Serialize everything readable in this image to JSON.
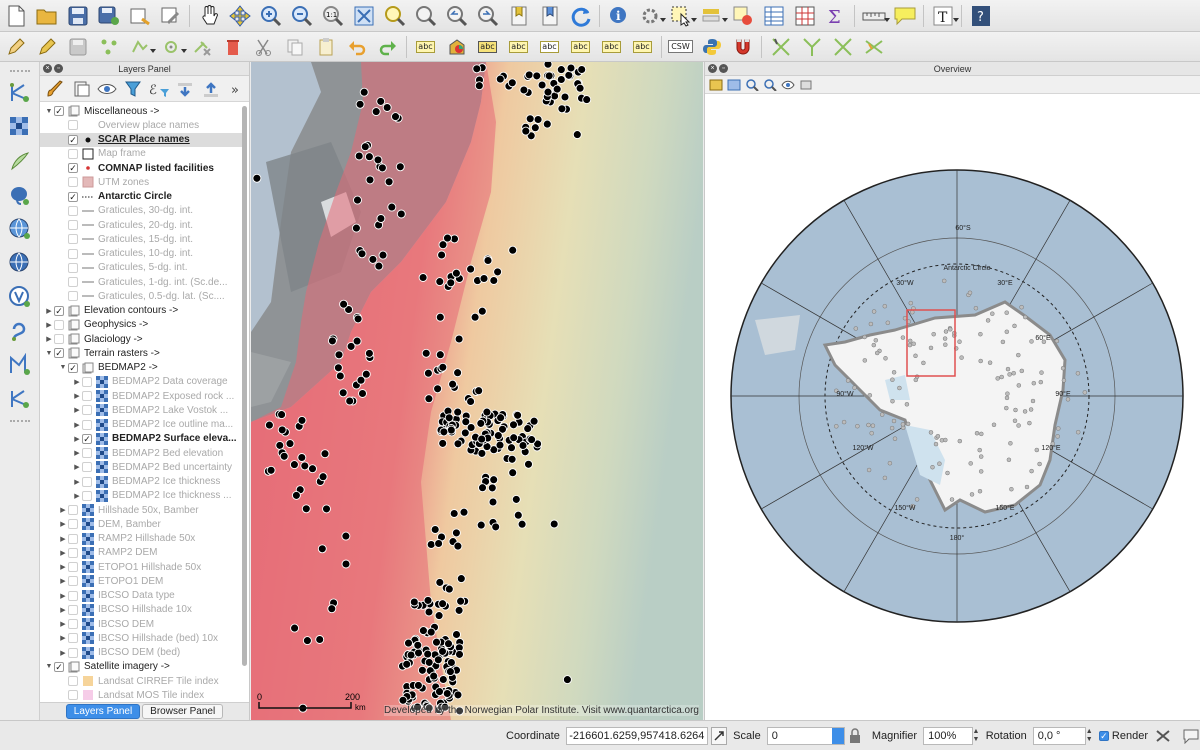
{
  "layers_panel": {
    "title": "Layers Panel",
    "rows": [
      {
        "label": "Miscellaneous ->",
        "kind": "group",
        "expanded": true,
        "checked": true,
        "indent": 0
      },
      {
        "label": "Overview place names",
        "kind": "layer",
        "checked": false,
        "indent": 1,
        "off": true,
        "symbol": "none"
      },
      {
        "label": "SCAR Place names",
        "kind": "layer",
        "checked": true,
        "indent": 1,
        "bold": true,
        "underline": true,
        "selected": true,
        "symbol": "dot"
      },
      {
        "label": "Map frame",
        "kind": "layer",
        "checked": false,
        "indent": 1,
        "off": true,
        "symbol": "square"
      },
      {
        "label": "COMNAP listed facilities",
        "kind": "layer",
        "checked": true,
        "indent": 1,
        "bold": true,
        "symbol": "reddot"
      },
      {
        "label": "UTM zones",
        "kind": "layer",
        "checked": false,
        "indent": 1,
        "off": true,
        "symbol": "pink"
      },
      {
        "label": "Antarctic Circle",
        "kind": "layer",
        "checked": true,
        "indent": 1,
        "bold": true,
        "symbol": "dotline"
      },
      {
        "label": "Graticules, 30-dg. int.",
        "kind": "layer",
        "checked": false,
        "indent": 1,
        "off": true,
        "symbol": "line"
      },
      {
        "label": "Graticules, 20-dg. int.",
        "kind": "layer",
        "checked": false,
        "indent": 1,
        "off": true,
        "symbol": "line"
      },
      {
        "label": "Graticules, 15-dg. int.",
        "kind": "layer",
        "checked": false,
        "indent": 1,
        "off": true,
        "symbol": "line"
      },
      {
        "label": "Graticules, 10-dg. int.",
        "kind": "layer",
        "checked": false,
        "indent": 1,
        "off": true,
        "symbol": "line"
      },
      {
        "label": "Graticules, 5-dg. int.",
        "kind": "layer",
        "checked": false,
        "indent": 1,
        "off": true,
        "symbol": "line"
      },
      {
        "label": "Graticules, 1-dg. int. (Sc.de...",
        "kind": "layer",
        "checked": false,
        "indent": 1,
        "off": true,
        "symbol": "line"
      },
      {
        "label": "Graticules, 0.5-dg. lat. (Sc....",
        "kind": "layer",
        "checked": false,
        "indent": 1,
        "off": true,
        "symbol": "line"
      },
      {
        "label": "Elevation contours ->",
        "kind": "group",
        "expanded": false,
        "checked": true,
        "indent": 0
      },
      {
        "label": "Geophysics ->",
        "kind": "group",
        "expanded": false,
        "checked": false,
        "indent": 0
      },
      {
        "label": "Glaciology ->",
        "kind": "group",
        "expanded": false,
        "checked": false,
        "indent": 0
      },
      {
        "label": "Terrain rasters ->",
        "kind": "group",
        "expanded": true,
        "checked": true,
        "indent": 0
      },
      {
        "label": "BEDMAP2 ->",
        "kind": "group",
        "expanded": true,
        "checked": true,
        "indent": 1
      },
      {
        "label": "BEDMAP2 Data coverage",
        "kind": "raster",
        "checked": false,
        "indent": 2,
        "off": true,
        "expandable": true
      },
      {
        "label": "BEDMAP2 Exposed rock ...",
        "kind": "raster",
        "checked": false,
        "indent": 2,
        "off": true,
        "expandable": true
      },
      {
        "label": "BEDMAP2 Lake Vostok ...",
        "kind": "raster",
        "checked": false,
        "indent": 2,
        "off": true,
        "expandable": true
      },
      {
        "label": "BEDMAP2 Ice outline ma...",
        "kind": "raster",
        "checked": false,
        "indent": 2,
        "off": true,
        "expandable": true
      },
      {
        "label": "BEDMAP2 Surface eleva...",
        "kind": "raster",
        "checked": true,
        "indent": 2,
        "bold": true,
        "expandable": true
      },
      {
        "label": "BEDMAP2 Bed elevation",
        "kind": "raster",
        "checked": false,
        "indent": 2,
        "off": true,
        "expandable": true
      },
      {
        "label": "BEDMAP2 Bed uncertainty",
        "kind": "raster",
        "checked": false,
        "indent": 2,
        "off": true,
        "expandable": true
      },
      {
        "label": "BEDMAP2 Ice thickness",
        "kind": "raster",
        "checked": false,
        "indent": 2,
        "off": true,
        "expandable": true
      },
      {
        "label": "BEDMAP2 Ice thickness ...",
        "kind": "raster",
        "checked": false,
        "indent": 2,
        "off": true,
        "expandable": true
      },
      {
        "label": "Hillshade 50x, Bamber",
        "kind": "raster",
        "checked": false,
        "indent": 1,
        "off": true,
        "expandable": true
      },
      {
        "label": "DEM, Bamber",
        "kind": "raster",
        "checked": false,
        "indent": 1,
        "off": true,
        "expandable": true
      },
      {
        "label": "RAMP2 Hillshade 50x",
        "kind": "raster",
        "checked": false,
        "indent": 1,
        "off": true,
        "expandable": true
      },
      {
        "label": "RAMP2 DEM",
        "kind": "raster",
        "checked": false,
        "indent": 1,
        "off": true,
        "expandable": true
      },
      {
        "label": "ETOPO1 Hillshade 50x",
        "kind": "raster",
        "checked": false,
        "indent": 1,
        "off": true,
        "expandable": true
      },
      {
        "label": "ETOPO1 DEM",
        "kind": "raster",
        "checked": false,
        "indent": 1,
        "off": true,
        "expandable": true
      },
      {
        "label": "IBCSO Data type",
        "kind": "raster",
        "checked": false,
        "indent": 1,
        "off": true,
        "expandable": true
      },
      {
        "label": "IBCSO Hillshade 10x",
        "kind": "raster",
        "checked": false,
        "indent": 1,
        "off": true,
        "expandable": true
      },
      {
        "label": "IBCSO DEM",
        "kind": "raster",
        "checked": false,
        "indent": 1,
        "off": true,
        "expandable": true
      },
      {
        "label": "IBCSO Hillshade (bed) 10x",
        "kind": "raster",
        "checked": false,
        "indent": 1,
        "off": true,
        "expandable": true
      },
      {
        "label": "IBCSO DEM (bed)",
        "kind": "raster",
        "checked": false,
        "indent": 1,
        "off": true,
        "expandable": true
      },
      {
        "label": "Satellite imagery ->",
        "kind": "group",
        "expanded": true,
        "checked": true,
        "indent": 0
      },
      {
        "label": "Landsat CIRREF Tile index",
        "kind": "layer",
        "checked": false,
        "indent": 1,
        "off": true,
        "symbol": "orange"
      },
      {
        "label": "Landsat MOS Tile index",
        "kind": "layer",
        "checked": false,
        "indent": 1,
        "off": true,
        "symbol": "pinkfill"
      }
    ],
    "tabs": [
      "Layers Panel",
      "Browser Panel"
    ]
  },
  "map_canvas": {
    "credit": "Developed by the Norwegian Polar Institute. Visit www.quantarctica.org",
    "scale_labels": [
      "0",
      "200",
      "km"
    ]
  },
  "overview": {
    "title": "Overview",
    "labels": [
      "60°S",
      "Antarctic Circle",
      "90°W",
      "90°E",
      "120°W",
      "120°E",
      "180°",
      "150°E",
      "60°E",
      "30°E",
      "30°W",
      "150°W"
    ]
  },
  "status_bar": {
    "coordinate_label": "Coordinate",
    "coordinate_value": "-216601.6259,957418.6264",
    "scale_label": "Scale",
    "scale_value": "0",
    "magnifier_label": "Magnifier",
    "magnifier_value": "100%",
    "rotation_label": "Rotation",
    "rotation_value": "0,0 °",
    "render_label": "Render",
    "render_checked": true
  },
  "icons": {
    "toolbar_main": [
      "new-project-icon",
      "open-project-icon",
      "save-project-icon",
      "save-as-icon",
      "new-print-composer-icon",
      "composer-manager-icon",
      "pan-icon",
      "pan-to-selection-icon",
      "zoom-in-icon",
      "zoom-out-icon",
      "zoom-native-icon",
      "zoom-full-icon",
      "zoom-to-selection-icon",
      "zoom-to-layer-icon",
      "zoom-last-icon",
      "zoom-next-icon",
      "new-bookmark-icon",
      "show-bookmarks-icon",
      "refresh-icon",
      "identify-icon",
      "measure-select-icon",
      "select-features-icon",
      "select-by-value-icon",
      "deselect-icon",
      "attribute-table-icon",
      "field-calculator-icon",
      "statistics-icon",
      "measure-icon",
      "annotation-icon",
      "text-annotation-icon",
      "help-icon"
    ],
    "toolbar_digitize": [
      "edit-pencil-icon",
      "toggle-editing-icon",
      "save-edits-icon",
      "add-feature-icon",
      "move-feature-icon",
      "node-tool-icon",
      "delete-selected-icon",
      "cut-features-icon",
      "copy-features-icon",
      "paste-features-icon",
      "undo-icon",
      "redo-icon",
      "label-icon",
      "diagram-icon",
      "pin-labels-icon",
      "highlight-pinned-icon",
      "show-hide-labels-icon",
      "move-label-icon",
      "rotate-label-icon",
      "change-label-icon",
      "csw-icon",
      "python-icon",
      "snapping-icon",
      "split-icon",
      "vertex-tool-icon",
      "intersection-icon",
      "merge-icon"
    ],
    "vertical": [
      "add-vector-icon",
      "add-raster-icon",
      "add-spatialite-icon",
      "add-postgis-icon",
      "add-wms-icon",
      "add-wfs-icon",
      "add-wcs-icon",
      "add-delimited-icon",
      "add-gpx-icon",
      "new-shapefile-icon"
    ]
  },
  "colors": {
    "selection": "#dcdcdc",
    "tab_active": "#3d8ee8",
    "ocean": "#a9bfd3",
    "elevation_low": "#e8707a",
    "elevation_high": "#c8d5b8",
    "point": "#000000",
    "overview_frame": "#e05050"
  }
}
